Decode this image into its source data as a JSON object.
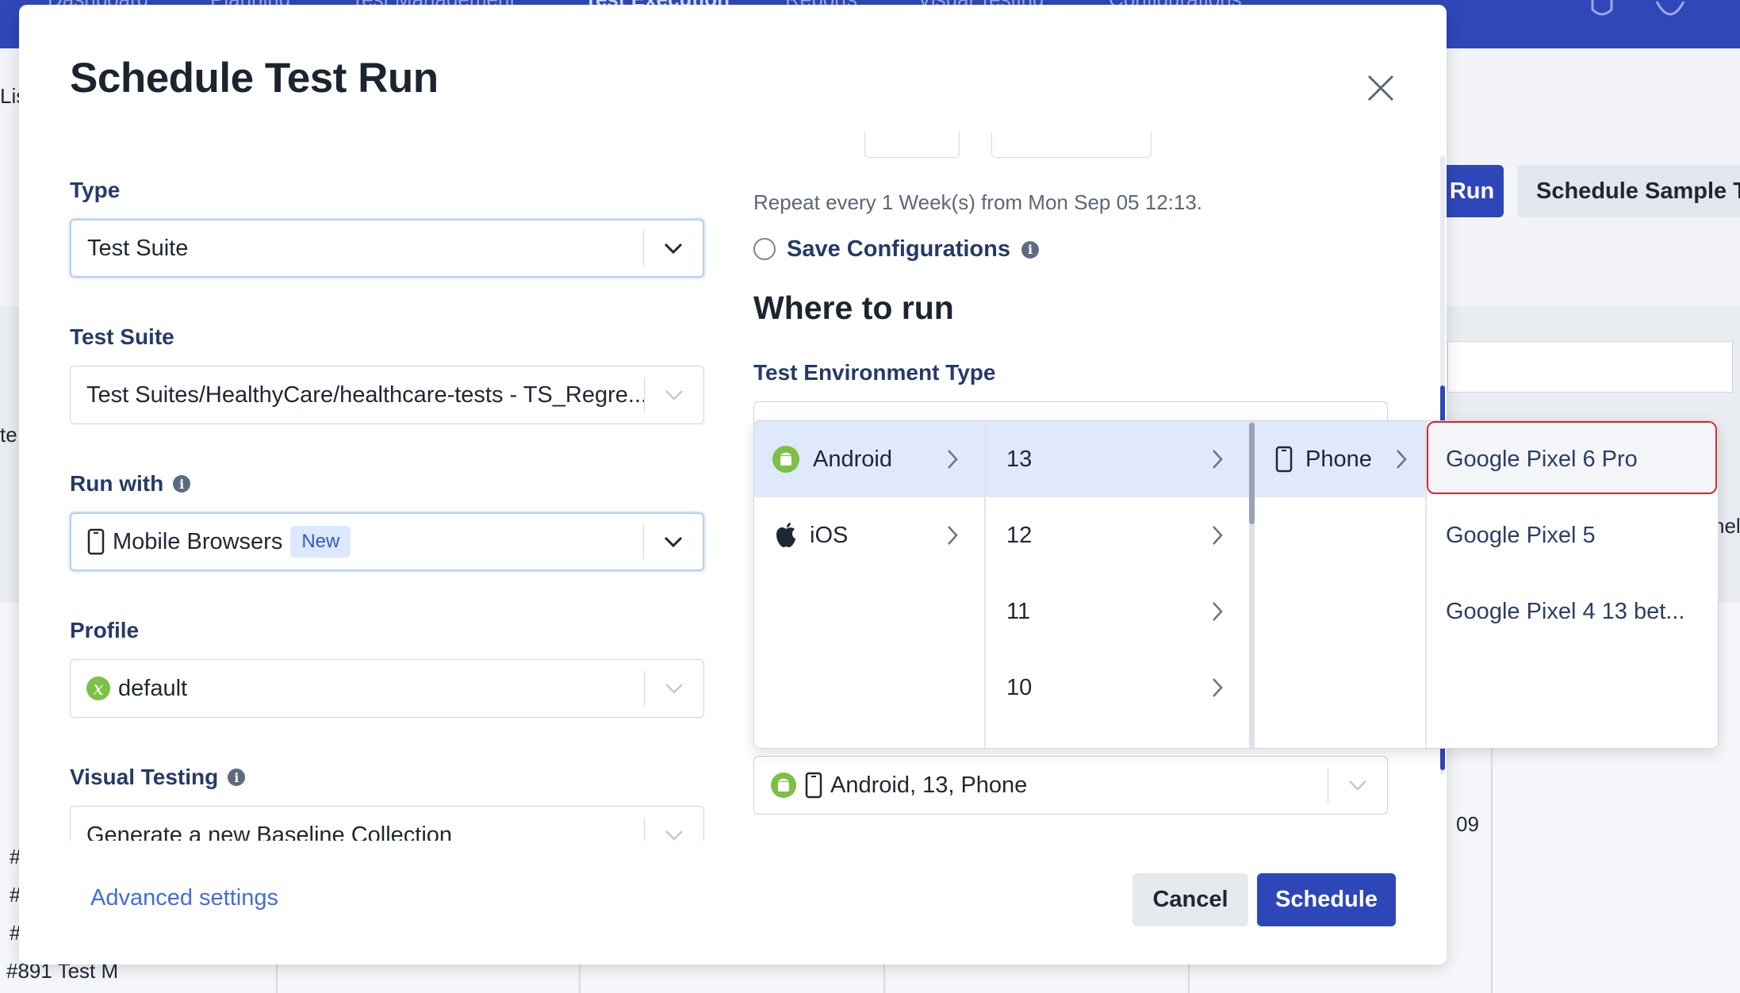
{
  "background": {
    "nav_items": [
      "Dashboard",
      "Planning",
      "Test Management",
      "Test Execution",
      "Reports",
      "Visual Testing",
      "Configurations"
    ],
    "run_button": "Run",
    "schedule_sample_button": "Schedule Sample Te",
    "left_fragments": [
      "Lis",
      "te"
    ],
    "right_fragment": "nel",
    "date_number": "09",
    "row_ids": [
      "#",
      "#",
      "#",
      "#891 Test M"
    ]
  },
  "modal": {
    "title": "Schedule Test Run",
    "type": {
      "label": "Type",
      "value": "Test Suite"
    },
    "test_suite": {
      "label": "Test Suite",
      "value": "Test Suites/HealthyCare/healthcare-tests - TS_Regre..."
    },
    "run_with": {
      "label": "Run with",
      "value": "Mobile Browsers",
      "badge": "New"
    },
    "profile": {
      "label": "Profile",
      "value": "default",
      "icon_letter": "x"
    },
    "visual_testing": {
      "label": "Visual Testing",
      "value": "Generate a new Baseline Collection"
    },
    "repeat_text": "Repeat every 1 Week(s) from Mon Sep 05 12:13.",
    "save_configurations": "Save Configurations",
    "where_heading": "Where to run",
    "env_type_label": "Test Environment Type",
    "env_value": "Android, 13, Phone",
    "advanced_settings": "Advanced settings",
    "cancel": "Cancel",
    "schedule": "Schedule"
  },
  "cascader": {
    "platforms": [
      "Android",
      "iOS"
    ],
    "versions": [
      "13",
      "12",
      "11",
      "10"
    ],
    "device_types": [
      "Phone"
    ],
    "devices": [
      "Google Pixel 6 Pro",
      "Google Pixel 5",
      "Google Pixel 4 13 bet..."
    ]
  },
  "colors": {
    "primary": "#2d47b8",
    "label": "#253a66",
    "link": "#3f6fd8",
    "selected_bg": "#dfe9fb",
    "highlight_border": "#d62630",
    "android_green": "#7cc044"
  }
}
